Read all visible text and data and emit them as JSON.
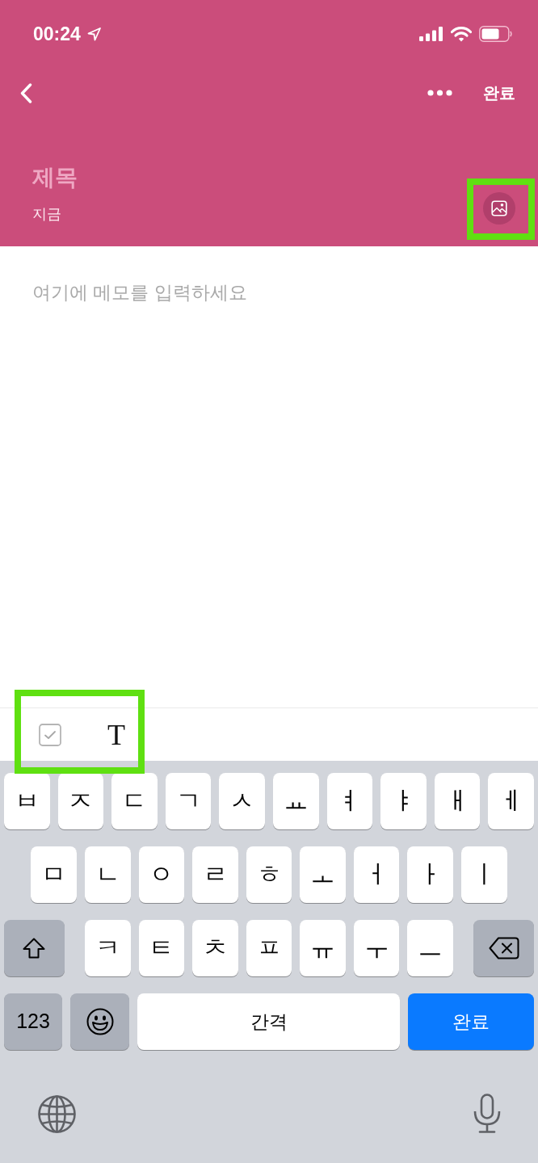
{
  "status_bar": {
    "time": "00:24"
  },
  "nav_bar": {
    "done_label": "완료"
  },
  "note": {
    "title_placeholder": "제목",
    "timestamp": "지금",
    "photo_button": {
      "highlighted": true
    },
    "body_placeholder": "여기에 메모를 입력하세요"
  },
  "format_toolbar": {
    "highlighted": true,
    "tools": [
      {
        "kind": "checklist"
      },
      {
        "kind": "text_style",
        "label": "T"
      }
    ]
  },
  "keyboard": {
    "key_rows": [
      {
        "keys": [
          {
            "kind": "char",
            "label": "ㅂ"
          },
          {
            "kind": "char",
            "label": "ㅈ"
          },
          {
            "kind": "char",
            "label": "ㄷ"
          },
          {
            "kind": "char",
            "label": "ㄱ"
          },
          {
            "kind": "char",
            "label": "ㅅ"
          },
          {
            "kind": "char",
            "label": "ㅛ"
          },
          {
            "kind": "char",
            "label": "ㅕ"
          },
          {
            "kind": "char",
            "label": "ㅑ"
          },
          {
            "kind": "char",
            "label": "ㅐ"
          },
          {
            "kind": "char",
            "label": "ㅔ"
          }
        ]
      },
      {
        "keys": [
          {
            "kind": "char",
            "label": "ㅁ"
          },
          {
            "kind": "char",
            "label": "ㄴ"
          },
          {
            "kind": "char",
            "label": "ㅇ"
          },
          {
            "kind": "char",
            "label": "ㄹ"
          },
          {
            "kind": "char",
            "label": "ㅎ"
          },
          {
            "kind": "char",
            "label": "ㅗ"
          },
          {
            "kind": "char",
            "label": "ㅓ"
          },
          {
            "kind": "char",
            "label": "ㅏ"
          },
          {
            "kind": "char",
            "label": "ㅣ"
          }
        ]
      },
      {
        "keys": [
          {
            "kind": "shift"
          },
          {
            "kind": "char",
            "label": "ㅋ"
          },
          {
            "kind": "char",
            "label": "ㅌ"
          },
          {
            "kind": "char",
            "label": "ㅊ"
          },
          {
            "kind": "char",
            "label": "ㅍ"
          },
          {
            "kind": "char",
            "label": "ㅠ"
          },
          {
            "kind": "char",
            "label": "ㅜ"
          },
          {
            "kind": "char",
            "label": "ㅡ"
          },
          {
            "kind": "backspace"
          }
        ]
      },
      {
        "keys": [
          {
            "kind": "mode",
            "label": "123"
          },
          {
            "kind": "emoji"
          },
          {
            "kind": "space",
            "label": "간격"
          },
          {
            "kind": "return",
            "label": "완료"
          }
        ]
      }
    ]
  }
}
